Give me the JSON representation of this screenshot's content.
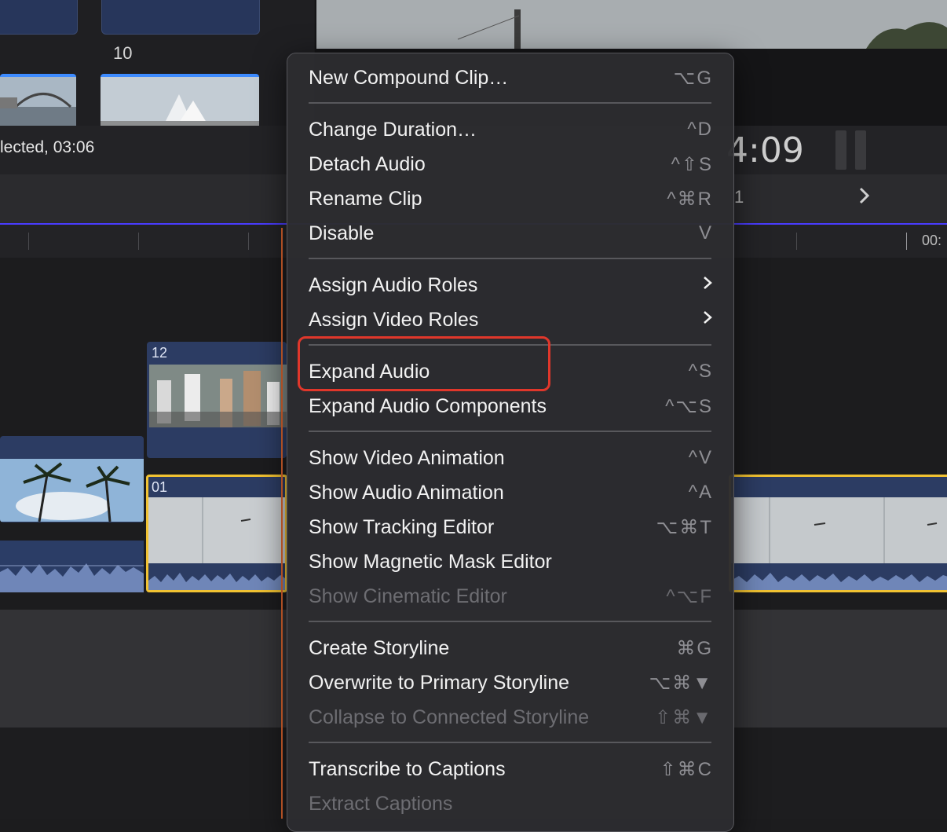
{
  "browser": {
    "clip_number_10": "10"
  },
  "info_bar": {
    "selection_text": "lected, 03:06",
    "timecode": "4:09"
  },
  "toolbar": {
    "partial_text": "1",
    "ruler_label": "00:"
  },
  "timeline": {
    "clip_12_label": "12",
    "clip_01_label": "01"
  },
  "menu": {
    "items": [
      {
        "label": "New Compound Clip…",
        "shortcut": "⌥G",
        "enabled": true
      },
      {
        "label": "Change Duration…",
        "shortcut": "^D",
        "enabled": true
      },
      {
        "label": "Detach Audio",
        "shortcut": "^⇧S",
        "enabled": true
      },
      {
        "label": "Rename Clip",
        "shortcut": "^⌘R",
        "enabled": true
      },
      {
        "label": "Disable",
        "shortcut": "V",
        "enabled": true
      },
      {
        "label": "Assign Audio Roles",
        "submenu": true,
        "enabled": true
      },
      {
        "label": "Assign Video Roles",
        "submenu": true,
        "enabled": true
      },
      {
        "label": "Expand Audio",
        "shortcut": "^S",
        "enabled": true,
        "highlighted": true
      },
      {
        "label": "Expand Audio Components",
        "shortcut": "^⌥S",
        "enabled": true
      },
      {
        "label": "Show Video Animation",
        "shortcut": "^V",
        "enabled": true
      },
      {
        "label": "Show Audio Animation",
        "shortcut": "^A",
        "enabled": true
      },
      {
        "label": "Show Tracking Editor",
        "shortcut": "⌥⌘T",
        "enabled": true
      },
      {
        "label": "Show Magnetic Mask Editor",
        "shortcut": "",
        "enabled": true
      },
      {
        "label": "Show Cinematic Editor",
        "shortcut": "^⌥F",
        "enabled": false
      },
      {
        "label": "Create Storyline",
        "shortcut": "⌘G",
        "enabled": true
      },
      {
        "label": "Overwrite to Primary Storyline",
        "shortcut": "⌥⌘▼",
        "enabled": true
      },
      {
        "label": "Collapse to Connected Storyline",
        "shortcut": "⇧⌘▼",
        "enabled": false
      },
      {
        "label": "Transcribe to Captions",
        "shortcut": "⇧⌘C",
        "enabled": true
      },
      {
        "label": "Extract Captions",
        "shortcut": "",
        "enabled": false
      }
    ]
  },
  "colors": {
    "highlight_box": "#e0372b",
    "selected_clip_border": "#f1c232",
    "playhead": "#e0662f"
  }
}
